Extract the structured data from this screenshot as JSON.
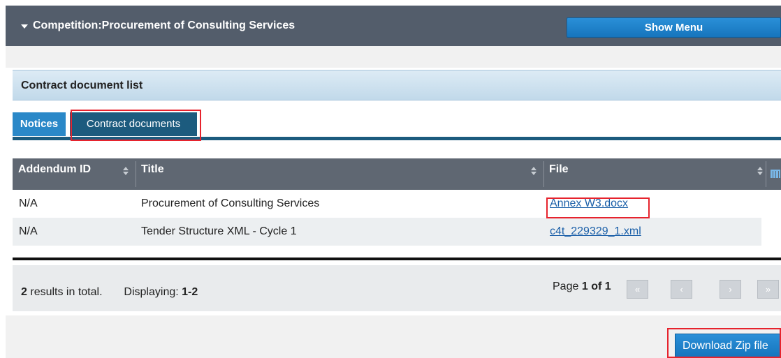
{
  "header": {
    "title": "Competition:Procurement of Consulting Services",
    "show_menu_label": "Show Menu"
  },
  "section": {
    "title": "Contract document list"
  },
  "tabs": [
    {
      "label": "Notices"
    },
    {
      "label": "Contract documents",
      "selected": true
    }
  ],
  "table": {
    "columns": [
      "Addendum ID",
      "Title",
      "File"
    ],
    "rows": [
      {
        "addendum_id": "N/A",
        "title": "Procurement of Consulting Services",
        "file": "Annex W3.docx"
      },
      {
        "addendum_id": "N/A",
        "title": "Tender Structure XML - Cycle 1",
        "file": "c4t_229329_1.xml"
      }
    ]
  },
  "pager": {
    "total_count": "2",
    "total_suffix": "results in total.",
    "displaying_label": "Displaying:",
    "displaying_range": "1-2",
    "page_label": "Page",
    "page_current": "1",
    "page_of": "of",
    "page_total": "1",
    "first_symbol": "«",
    "prev_symbol": "‹",
    "next_symbol": "›",
    "last_symbol": "»"
  },
  "download_label": "Download Zip file",
  "colors": {
    "topbar": "#535d6b",
    "accent_blue": "#1675bd",
    "active_tab": "#1c5b7e",
    "highlight": "#e6232d"
  }
}
